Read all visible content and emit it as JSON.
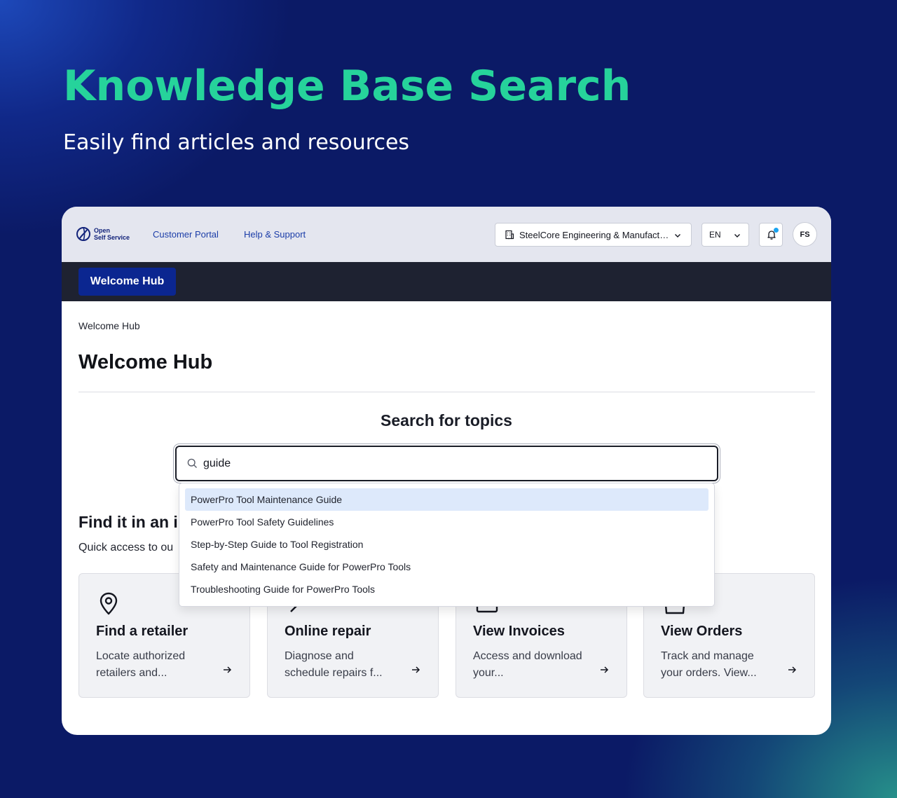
{
  "hero": {
    "title": "Knowledge Base Search",
    "subtitle": "Easily find articles and resources"
  },
  "header": {
    "logo_line1": "Open",
    "logo_line2": "Self Service",
    "nav": [
      "Customer Portal",
      "Help & Support"
    ],
    "organization": "SteelCore Engineering & Manufacturing",
    "language": "EN",
    "avatar_initials": "FS",
    "has_notifications": true
  },
  "tabs": {
    "active": "Welcome Hub"
  },
  "page": {
    "breadcrumb": "Welcome Hub",
    "title": "Welcome Hub"
  },
  "search": {
    "heading": "Search for topics",
    "value": "guide",
    "suggestions": [
      "PowerPro Tool Maintenance Guide",
      "PowerPro Tool Safety Guidelines",
      "Step-by-Step Guide to Tool Registration",
      "Safety and Maintenance Guide for PowerPro Tools",
      "Troubleshooting Guide for PowerPro Tools"
    ],
    "highlighted_index": 0
  },
  "section": {
    "title": "Find it in an ir",
    "subtitle": "Quick access to ou"
  },
  "tiles": [
    {
      "icon": "map-pin-icon",
      "title": "Find a retailer",
      "desc": "Locate authorized retailers and..."
    },
    {
      "icon": "wrench-icon",
      "title": "Online repair",
      "desc": "Diagnose and schedule repairs f..."
    },
    {
      "icon": "invoice-icon",
      "title": "View Invoices",
      "desc": "Access and download your..."
    },
    {
      "icon": "package-icon",
      "title": "View Orders",
      "desc": "Track and manage your orders. View..."
    }
  ],
  "colors": {
    "hero_title": "#26d39b",
    "accent_tab": "#0b2690",
    "tabbar": "#1e2231",
    "topbar": "#e4e6ef",
    "suggestion_highlight": "#dde9fb",
    "notification_dot": "#1aa3f0"
  }
}
